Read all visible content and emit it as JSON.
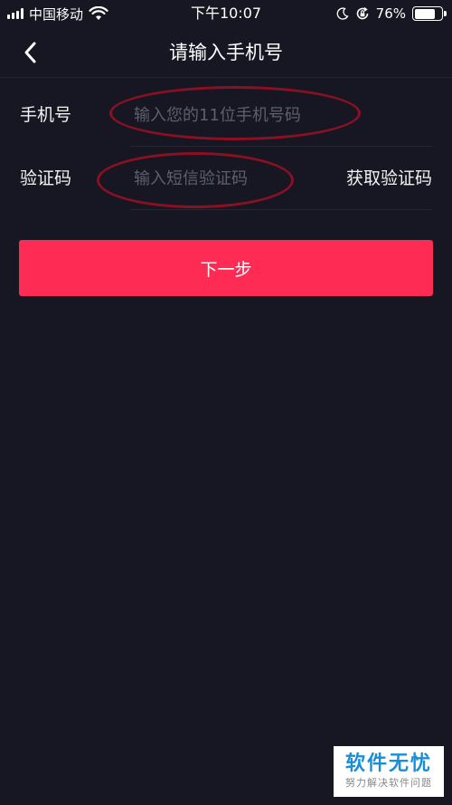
{
  "status_bar": {
    "carrier": "中国移动",
    "time": "下午10:07",
    "battery_percent": "76%",
    "battery_level": 0.76,
    "icons": [
      "signal-icon",
      "wifi-icon",
      "moon-icon",
      "rotation-lock-icon",
      "battery-icon"
    ]
  },
  "header": {
    "title": "请输入手机号",
    "back_icon": "chevron-left-icon"
  },
  "form": {
    "phone": {
      "label": "手机号",
      "placeholder": "输入您的11位手机号码",
      "value": ""
    },
    "code": {
      "label": "验证码",
      "placeholder": "输入短信验证码",
      "value": "",
      "get_code_label": "获取验证码"
    }
  },
  "next_button": {
    "label": "下一步"
  },
  "watermark": {
    "title": "软件无忧",
    "subtitle": "努力解决软件问题"
  },
  "colors": {
    "background": "#161722",
    "accent": "#fe2c55",
    "annotation": "#8c1023",
    "placeholder": "#5d5f6c"
  }
}
